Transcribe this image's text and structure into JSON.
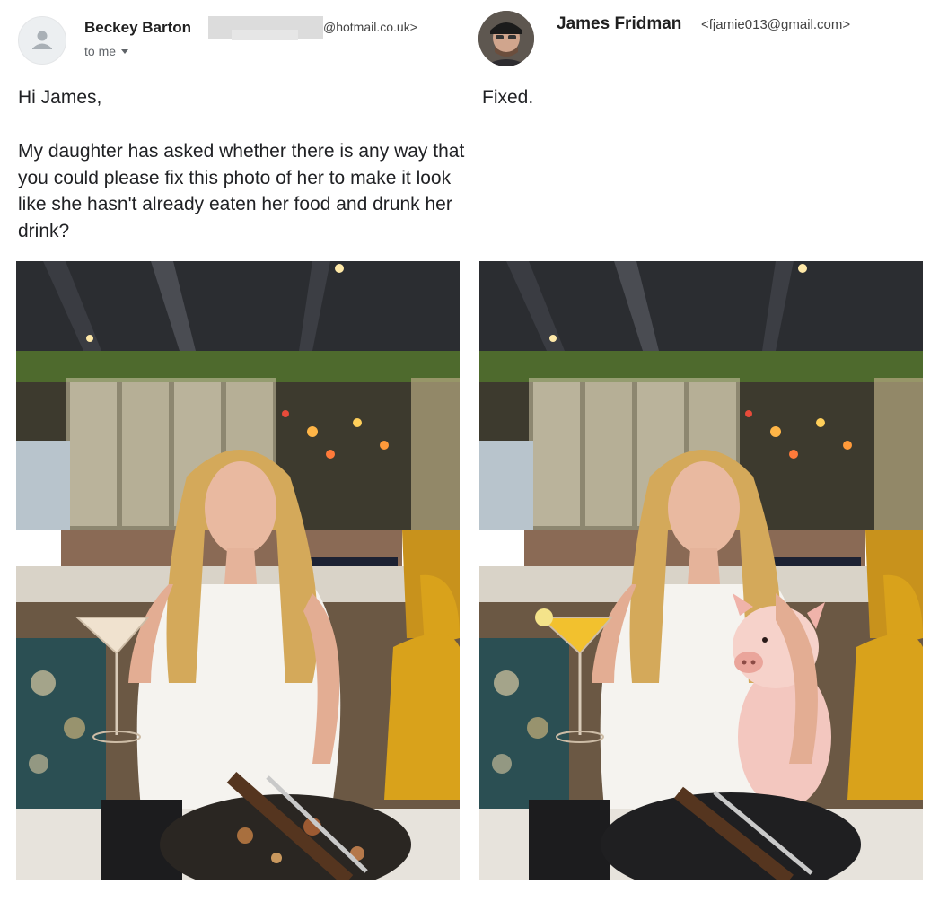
{
  "left_email": {
    "sender_name": "Beckey Barton",
    "sender_email_suffix": "@hotmail.co.uk>",
    "recipient_label": "to me",
    "greeting": "Hi James,",
    "body": "My daughter has asked whether there is any way that you could please fix this photo of her to make it look like she hasn't already eaten her food and drunk her drink?",
    "avatar_icon": "person-icon",
    "photo_alt": "woman holding an empty cocktail glass with an eaten plate of food"
  },
  "right_email": {
    "sender_name": "James Fridman",
    "sender_email": "<fjamie013@gmail.com>",
    "body": "Fixed.",
    "photo_alt": "same woman holding a full cocktail glass and a piglet over an empty plate"
  },
  "colors": {
    "drink_full": "#f2c12e",
    "chair_mustard": "#d9a21b",
    "piglet_pink": "#f3c7bf"
  }
}
